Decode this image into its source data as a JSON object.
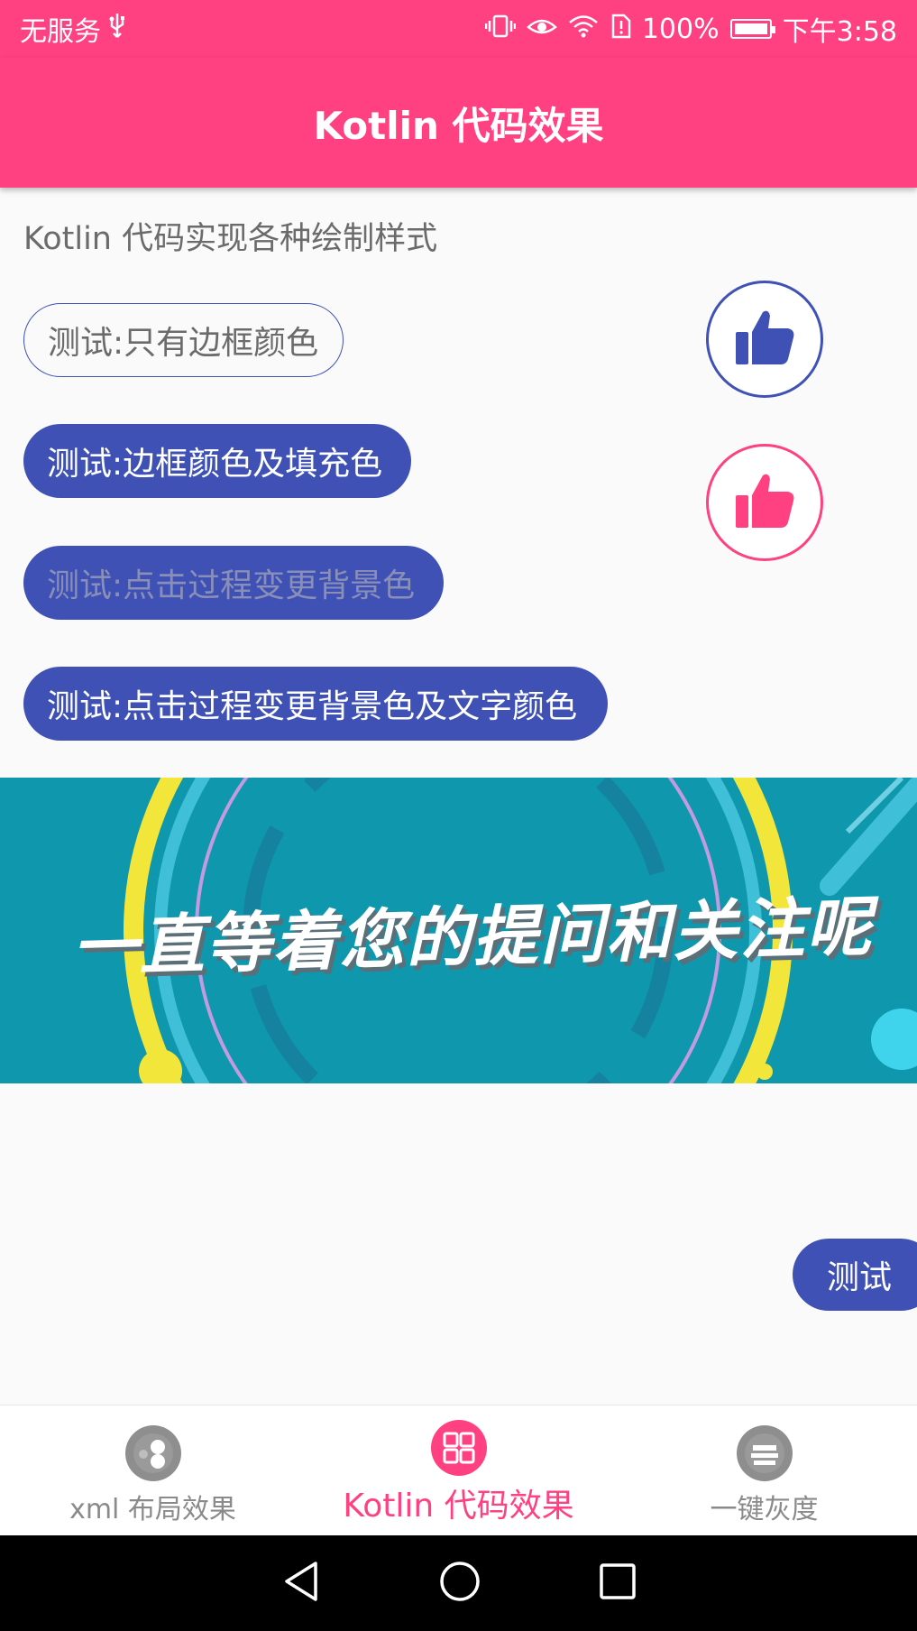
{
  "status_bar": {
    "carrier": "无服务",
    "usb_icon": "usb-icon",
    "battery_percent": "100%",
    "time": "下午3:58"
  },
  "app_bar": {
    "title": "Kotlin 代码效果"
  },
  "content": {
    "subtitle": "Kotlin 代码实现各种绘制样式",
    "buttons": [
      {
        "label": "测试:只有边框颜色"
      },
      {
        "label": "测试:边框颜色及填充色"
      },
      {
        "label": "测试:点击过程变更背景色"
      },
      {
        "label": "测试:点击过程变更背景色及文字颜色"
      }
    ],
    "like_icons": [
      "thumbs-up-icon",
      "thumbs-up-icon"
    ],
    "banner_text": "一直等着您的提问和关注呢",
    "test_button": "测试"
  },
  "bottom_nav": {
    "items": [
      {
        "label": "xml 布局效果",
        "icon": "lottery-ball-icon",
        "active": false
      },
      {
        "label": "Kotlin 代码效果",
        "icon": "grid-icon",
        "active": true
      },
      {
        "label": "一键灰度",
        "icon": "union-lotto-icon",
        "active": false
      }
    ]
  },
  "colors": {
    "accent": "#ff4081",
    "primary": "#3f51b5",
    "banner_bg": "#0f97ad"
  }
}
